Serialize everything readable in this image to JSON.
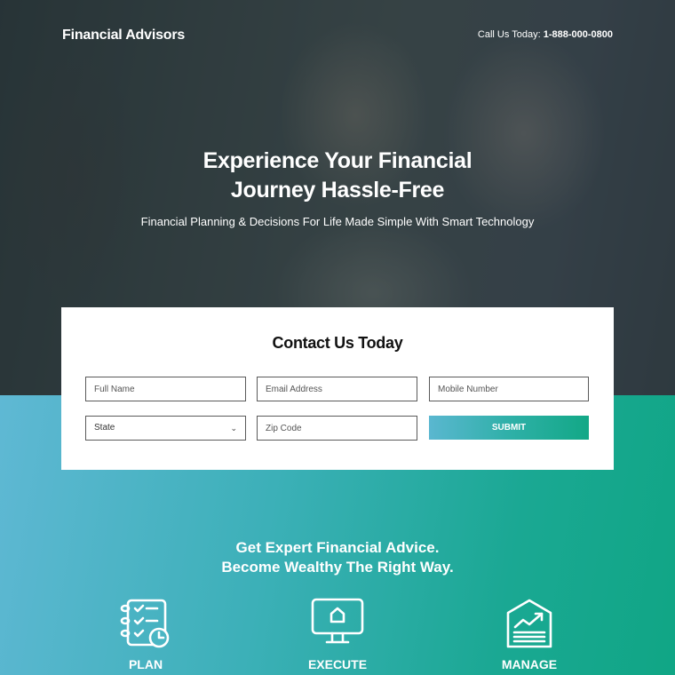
{
  "header": {
    "brand": "Financial Advisors",
    "call_label": "Call Us Today:",
    "phone": "1-888-000-0800"
  },
  "hero": {
    "title_line1": "Experience Your Financial",
    "title_line2": "Journey Hassle-Free",
    "subtitle": "Financial Planning & Decisions For Life Made Simple With Smart Technology"
  },
  "form": {
    "title": "Contact Us Today",
    "fields": {
      "full_name": {
        "placeholder": "Full Name",
        "value": ""
      },
      "email": {
        "placeholder": "Email Address",
        "value": ""
      },
      "mobile": {
        "placeholder": "Mobile Number",
        "value": ""
      },
      "state": {
        "selected": "State"
      },
      "zip": {
        "placeholder": "Zip Code",
        "value": ""
      }
    },
    "submit_label": "SUBMIT"
  },
  "section": {
    "title_line1": "Get Expert Financial Advice.",
    "title_line2": "Become Wealthy The Right Way.",
    "features": [
      {
        "icon": "checklist-clock-icon",
        "label": "PLAN"
      },
      {
        "icon": "monitor-home-icon",
        "label": "EXECUTE"
      },
      {
        "icon": "house-growth-chart-icon",
        "label": "MANAGE"
      }
    ]
  },
  "colors": {
    "gradient_start": "#5fb8d4",
    "gradient_end": "#10a685",
    "text_light": "#ffffff"
  }
}
